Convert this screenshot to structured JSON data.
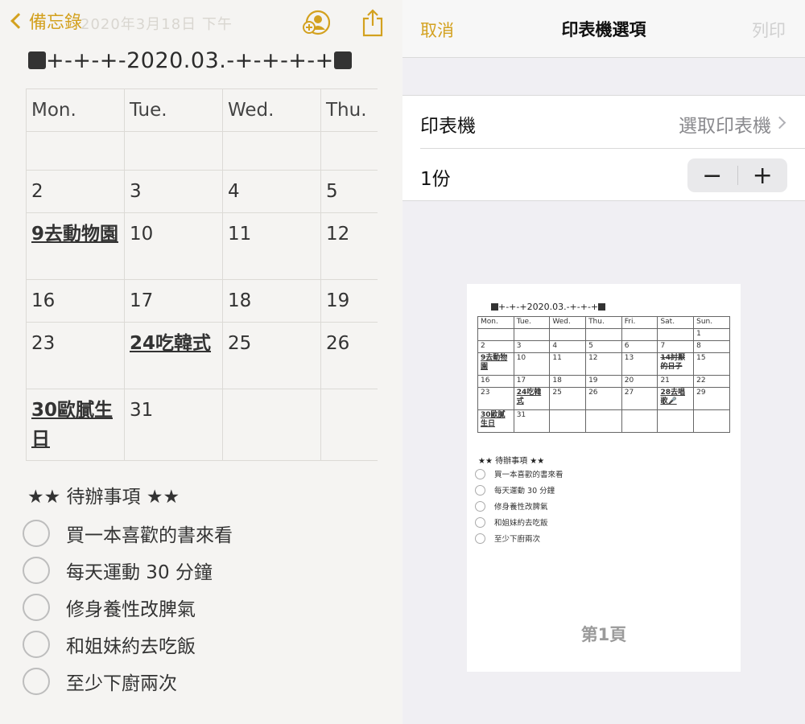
{
  "notes": {
    "back_label": "備忘錄",
    "faint_header": "2020年3月18日 下午",
    "title": "+-+-+-2020.03.-+-+-+-+",
    "calendar": {
      "headers": [
        "Mon.",
        "Tue.",
        "Wed.",
        "Thu."
      ],
      "rows": [
        [
          "",
          "",
          "",
          ""
        ],
        [
          "2",
          "3",
          "4",
          "5"
        ],
        [
          "9去動物園",
          "10",
          "11",
          "12"
        ],
        [
          "16",
          "17",
          "18",
          "19"
        ],
        [
          "23",
          "24吃韓式",
          "25",
          "26"
        ],
        [
          "30歐膩生日",
          "31",
          "",
          ""
        ]
      ]
    },
    "todo_title": "★★ 待辦事項 ★★",
    "todos": [
      "買一本喜歡的書來看",
      "每天運動 30 分鐘",
      "修身養性改脾氣",
      "和姐妹約去吃飯",
      "至少下廚兩次"
    ]
  },
  "print": {
    "cancel": "取消",
    "title": "印表機選項",
    "print": "列印",
    "printer_label": "印表機",
    "printer_value": "選取印表機",
    "copies_label": "1份",
    "minus": "−",
    "plus": "+",
    "preview": {
      "title": "+-+-+2020.03.-+-+-+",
      "headers": [
        "Mon.",
        "Tue.",
        "Wed.",
        "Thu.",
        "Fri.",
        "Sat.",
        "Sun."
      ],
      "rows": [
        [
          "",
          "",
          "",
          "",
          "",
          "",
          "1"
        ],
        [
          "2",
          "3",
          "4",
          "5",
          "6",
          "7",
          "8"
        ],
        [
          "9去動物園",
          "10",
          "11",
          "12",
          "13",
          "14討厭的日子",
          "15"
        ],
        [
          "16",
          "17",
          "18",
          "19",
          "20",
          "21",
          "22"
        ],
        [
          "23",
          "24吃韓式",
          "25",
          "26",
          "27",
          "28去唱歌🎤",
          "29"
        ],
        [
          "30歐膩生日",
          "31",
          "",
          "",
          "",
          "",
          ""
        ]
      ],
      "todo_title": "★★ 待辦事項 ★★",
      "todos": [
        "買一本喜歡的書來看",
        "每天運動 30 分鐘",
        "修身養性改脾氣",
        "和姐妹約去吃飯",
        "至少下廚兩次"
      ],
      "page_label": "第1頁"
    }
  },
  "colors": {
    "accent": "#d3a11f",
    "muted": "#8a8a8e"
  }
}
